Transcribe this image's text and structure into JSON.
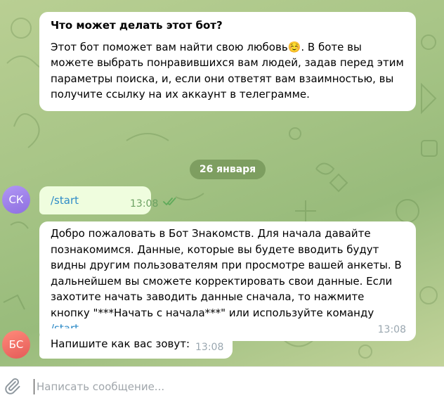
{
  "bot_info": {
    "title": "Что может делать этот бот?",
    "text_before_emoji": "Этот бот поможет вам найти свою любовь",
    "emoji": "☺️",
    "text_after_emoji": ". В боте вы можете выбрать понравившихся вам людей, задав перед этим параметры поиска, и, если они ответят вам взаимностью, вы получите ссылку на их аккаунт в телеграмме."
  },
  "date_separator": "26 января",
  "messages": [
    {
      "avatar": "СК",
      "text": "/start",
      "time": "13:08",
      "status_icon": "double-check-icon"
    },
    {
      "text": "Добро пожаловать в Бот Знакомств. Для начала давайте познакомимся. Данные, которые вы будете вводить будут видны другим пользователям при просмотре вашей анкеты. В дальнейшем вы сможете корректировать свои данные. Если захотите начать заводить данные сначала, то нажмите  кнопку \"***Начать с начала***\" или используйте команду ",
      "command": "/start",
      "time": "13:08"
    },
    {
      "avatar": "БС",
      "text": "Напишите как вас зовут:",
      "time": "13:08"
    }
  ],
  "composer": {
    "placeholder": "Написать сообщение...",
    "attach_icon": "paperclip-icon"
  },
  "colors": {
    "outgoing_bubble": "#effdde",
    "link": "#2e8bc7",
    "avatar_sk": "#9b7fee",
    "avatar_bs": "#f07068"
  }
}
